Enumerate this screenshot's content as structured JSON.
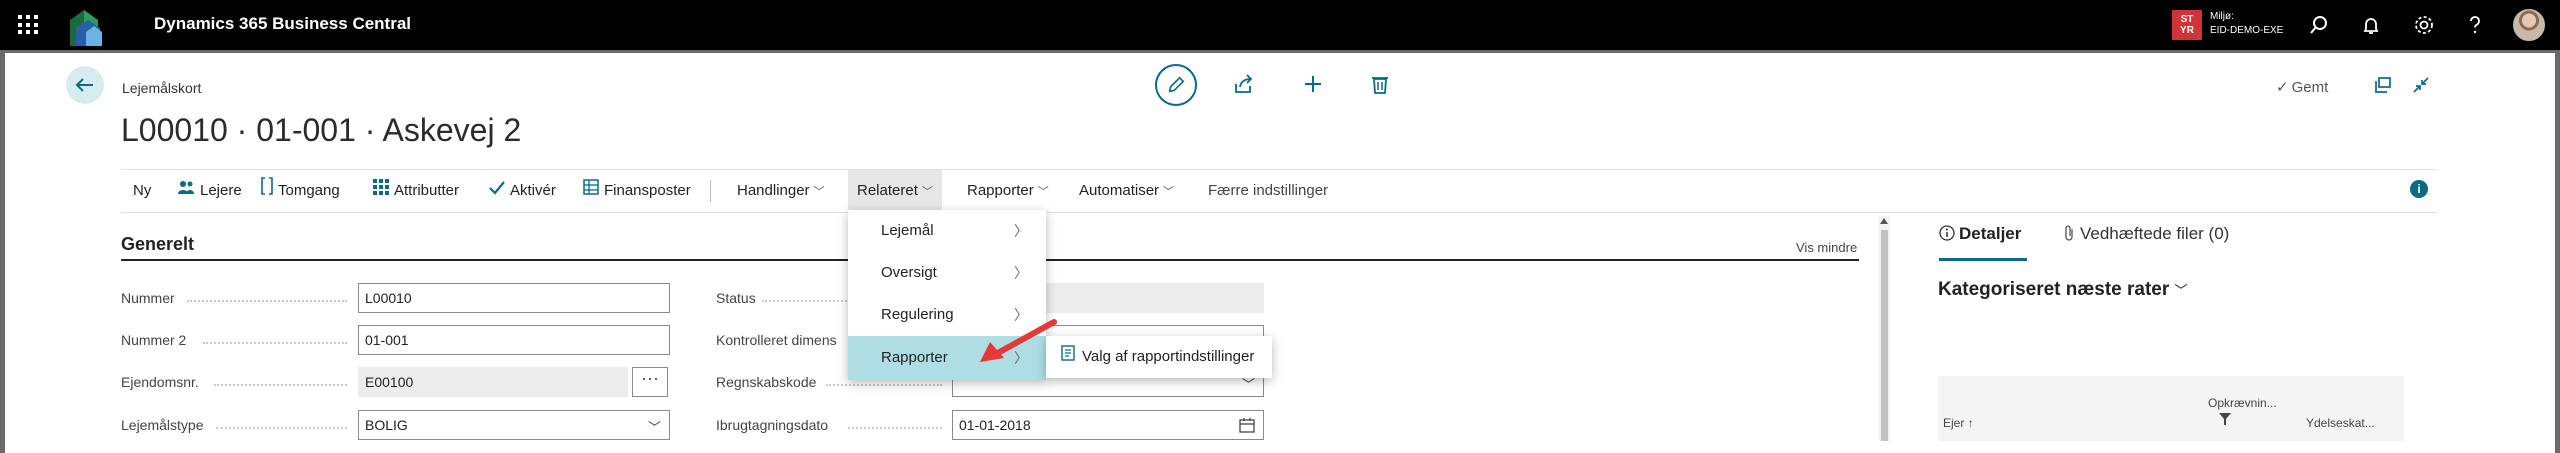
{
  "topbar": {
    "app_title": "Dynamics 365 Business Central",
    "env_badge_line1": "ST",
    "env_badge_line2": "YR",
    "env_label_line1": "Miljø:",
    "env_label_line2": "EID-DEMO-EXE",
    "icons": [
      "waffle-icon",
      "search-icon",
      "bell-icon",
      "gear-icon",
      "help-icon",
      "avatar"
    ]
  },
  "page": {
    "caption": "Lejemålskort",
    "title": "L00010 · 01-001 · Askevej 2",
    "saved_label": "Gemt"
  },
  "actionbar": {
    "items": [
      {
        "label": "Ny"
      },
      {
        "label": "Lejere",
        "icon": "people-icon"
      },
      {
        "label": "Tomgang",
        "icon": "bracket-icon"
      },
      {
        "label": "Attributter",
        "icon": "grid-icon"
      },
      {
        "label": "Aktivér",
        "icon": "check-icon"
      },
      {
        "label": "Finansposter",
        "icon": "ledger-icon"
      },
      {
        "label": "Handlinger"
      },
      {
        "label": "Relateret"
      },
      {
        "label": "Rapporter"
      },
      {
        "label": "Automatiser"
      },
      {
        "label": "Færre indstillinger"
      }
    ],
    "info_label": "i"
  },
  "section": {
    "title": "Generelt",
    "toggle_label": "Vis mindre"
  },
  "fields": {
    "nummer": {
      "label": "Nummer",
      "value": "L00010"
    },
    "nummer2": {
      "label": "Nummer 2",
      "value": "01-001"
    },
    "ejendomsnr": {
      "label": "Ejendomsnr.",
      "value": "E00100"
    },
    "lejemaalstype": {
      "label": "Lejemålstype",
      "value": "BOLIG"
    },
    "status": {
      "label": "Status",
      "value": ""
    },
    "kontrolleret": {
      "label": "Kontrolleret dimens",
      "value": ""
    },
    "regnskabskode": {
      "label": "Regnskabskode",
      "value": ""
    },
    "ibrugtagning": {
      "label": "Ibrugtagningsdato",
      "value": "01-01-2018"
    }
  },
  "assist_label": "···",
  "dropdown": {
    "items": [
      {
        "label": "Lejemål"
      },
      {
        "label": "Oversigt"
      },
      {
        "label": "Regulering"
      },
      {
        "label": "Rapporter"
      }
    ],
    "submenu_label": "Valg af rapportindstillinger"
  },
  "factbox": {
    "tab_details": "Detaljer",
    "tab_attachments": "Vedhæftede filer (0)",
    "heading": "Kategoriseret næste rater",
    "col_ejer": "Ejer",
    "col_opkraevning": "Opkrævnin...",
    "col_ydelse": "Ydelseskat..."
  },
  "colors": {
    "accent": "#0b6a84",
    "hover": "#afdde4",
    "badge": "#d13438"
  }
}
